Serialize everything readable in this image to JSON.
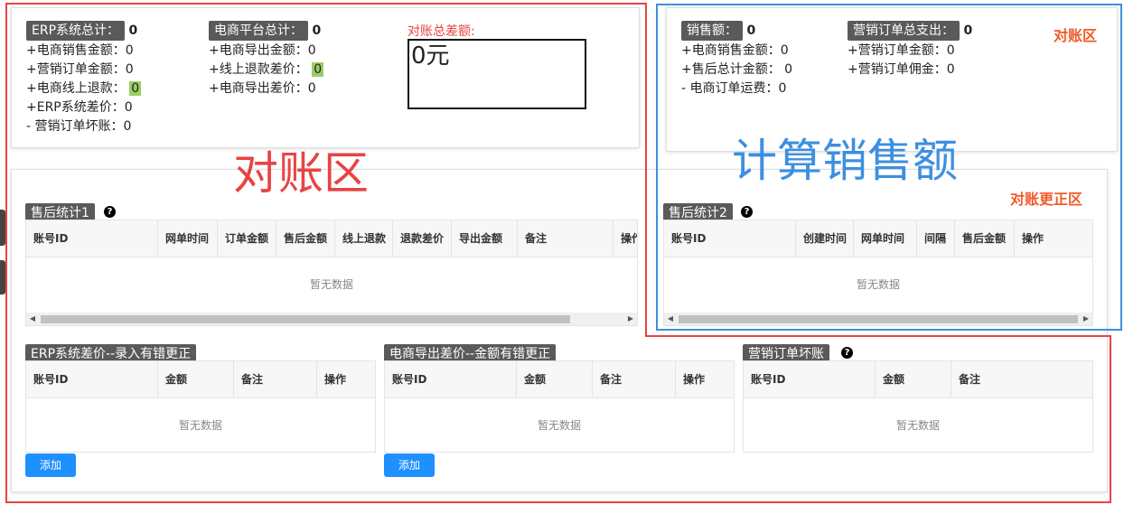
{
  "top_left": {
    "erp_total_label": "ERP系统总计：",
    "erp_total_value": "0",
    "erp_lines": [
      "+电商销售金额：0",
      "+营销订单金额：0"
    ],
    "erp_refund_label": "+电商线上退款：",
    "erp_refund_value": "0",
    "erp_lines2": [
      "+ERP系统差价：0",
      "- 营销订单坏账：0"
    ],
    "ec_total_label": "电商平台总计：",
    "ec_total_value": "0",
    "ec_line1": "+电商导出金额：0",
    "ec_refund_label": "+线上退款差价：",
    "ec_refund_value": "0",
    "ec_line3": "+电商导出差价：0",
    "diff_label": "对账总差额:",
    "diff_value": "0元"
  },
  "top_right": {
    "sales_label": "销售额：",
    "sales_value": "0",
    "sales_lines": [
      "+电商销售金额：0",
      "+售后总计金额： 0",
      "- 电商订单运费：0"
    ],
    "marketing_label": "营销订单总支出：",
    "marketing_value": "0",
    "marketing_lines": [
      "+营销订单金额：0",
      "+营销订单佣金：0"
    ]
  },
  "annotations": {
    "recon_zone_big": "对账区",
    "calc_sales": "计算销售额",
    "recon_zone_small": "对账区",
    "recon_fix_zone": "对账更正区"
  },
  "after_sales1": {
    "title": "售后统计1",
    "columns": [
      "账号ID",
      "网单时间",
      "订单金额",
      "售后金额",
      "线上退款",
      "退款差价",
      "导出金额",
      "备注",
      "操作"
    ],
    "empty": "暂无数据"
  },
  "after_sales2": {
    "title": "售后统计2",
    "columns": [
      "账号ID",
      "创建时间",
      "网单时间",
      "间隔",
      "售后金额",
      "操作"
    ],
    "empty": "暂无数据"
  },
  "erp_diff": {
    "title": "ERP系统差价--录入有错更正",
    "columns": [
      "账号ID",
      "金额",
      "备注",
      "操作"
    ],
    "empty": "暂无数据",
    "add_label": "添加"
  },
  "ec_diff": {
    "title": "电商导出差价--金额有错更正",
    "columns": [
      "账号ID",
      "金额",
      "备注",
      "操作"
    ],
    "empty": "暂无数据",
    "add_label": "添加"
  },
  "bad_debt": {
    "title": "营销订单坏账",
    "columns": [
      "账号ID",
      "金额",
      "备注"
    ],
    "empty": "暂无数据"
  },
  "colors": {
    "accent": "#1e90ff",
    "red_annotation": "#e84343",
    "blue_annotation": "#3d8fe0",
    "orange_annotation": "#f05a28",
    "tag_bg": "#5a5a5a"
  }
}
